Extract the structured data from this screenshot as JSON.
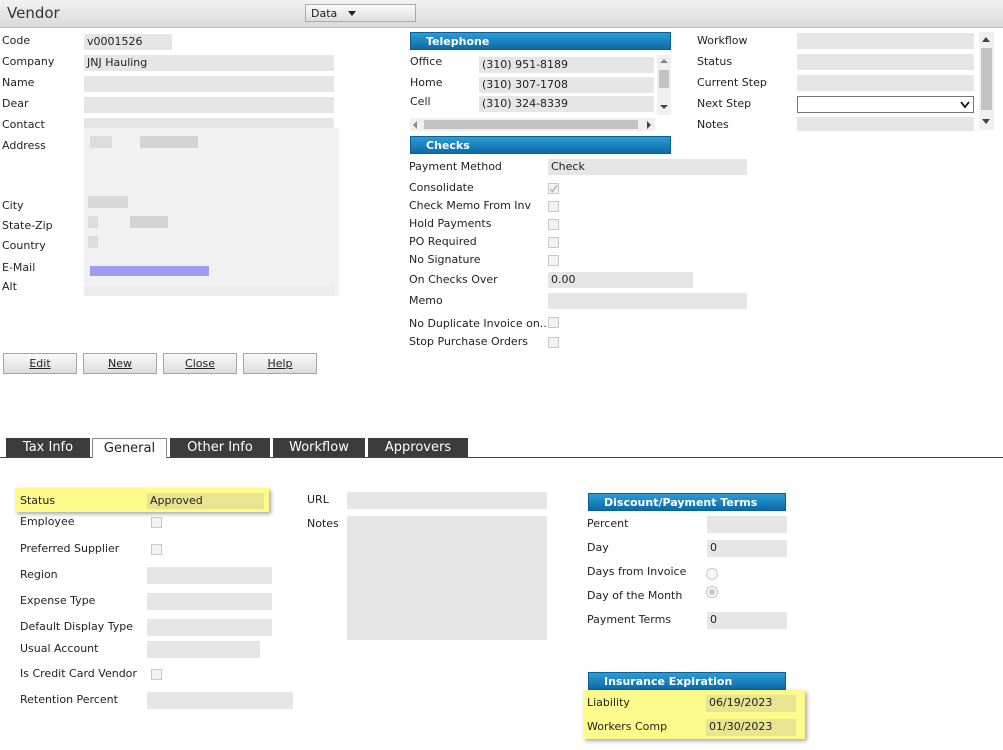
{
  "titlebar": {
    "title": "Vendor",
    "dropdown": "Data"
  },
  "vendor": {
    "labels": [
      "Code",
      "Company",
      "Name",
      "Dear",
      "Contact",
      "Address",
      "City",
      "State-Zip",
      "Country",
      "E-Mail",
      "Alt"
    ],
    "code": "v0001526",
    "company": "JNJ Hauling"
  },
  "telephone": {
    "header": "Telephone",
    "rows": [
      {
        "label": "Office",
        "value": "(310) 951-8189"
      },
      {
        "label": "Home",
        "value": "(310) 307-1708"
      },
      {
        "label": "Cell",
        "value": "(310) 324-8339"
      }
    ]
  },
  "checks": {
    "header": "Checks",
    "payment_method_label": "Payment Method",
    "payment_method": "Check",
    "consolidate": "Consolidate",
    "check_memo": "Check Memo From Inv",
    "hold_payments": "Hold Payments",
    "po_required": "PO Required",
    "no_signature": "No Signature",
    "on_checks_over_label": "On Checks Over",
    "on_checks_over": "0.00",
    "memo": "Memo",
    "no_duplicate": "No Duplicate Invoice on...",
    "stop_po": "Stop Purchase Orders"
  },
  "workflow": {
    "labels": [
      "Workflow",
      "Status",
      "Current Step",
      "Next Step",
      "Notes"
    ]
  },
  "buttons": {
    "edit": "Edit",
    "new": "New",
    "close": "Close",
    "help": "Help"
  },
  "tabs": [
    "Tax Info",
    "General",
    "Other Info",
    "Workflow",
    "Approvers"
  ],
  "general": {
    "status_label": "Status",
    "status": "Approved",
    "employee": "Employee",
    "preferred_supplier": "Preferred Supplier",
    "region": "Region",
    "expense_type": "Expense Type",
    "default_display_type": "Default Display Type",
    "usual_account": "Usual Account",
    "is_credit_card_vendor": "Is Credit Card Vendor",
    "retention_percent": "Retention Percent",
    "url": "URL",
    "notes": "Notes"
  },
  "discount": {
    "header": "Discount/Payment Terms",
    "percent": "Percent",
    "day": "Day",
    "day_value": "0",
    "days_from_invoice": "Days from Invoice",
    "day_of_month": "Day of the Month",
    "payment_terms": "Payment Terms",
    "payment_terms_value": "0"
  },
  "insurance": {
    "header": "Insurance Expiration",
    "liability": "Liability",
    "liability_date": "06/19/2023",
    "workers_comp": "Workers Comp",
    "workers_comp_date": "01/30/2023"
  },
  "colors": {
    "header_blue": "#0b6ba8",
    "highlight": "#fdfb8a",
    "email_blur": "#9f9cf0"
  }
}
